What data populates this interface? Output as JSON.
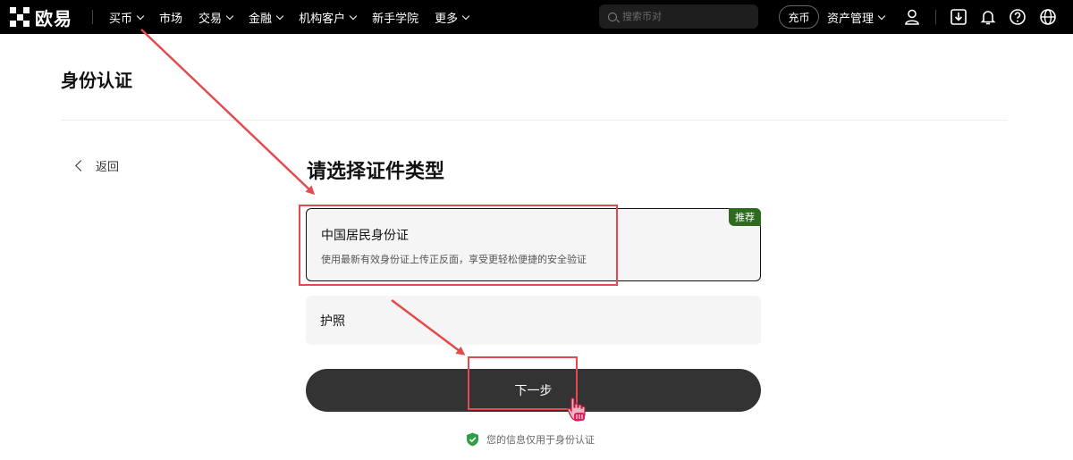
{
  "brand": {
    "name": "欧易"
  },
  "nav": {
    "items": [
      {
        "label": "买币",
        "dropdown": true
      },
      {
        "label": "市场",
        "dropdown": false
      },
      {
        "label": "交易",
        "dropdown": true
      },
      {
        "label": "金融",
        "dropdown": true
      },
      {
        "label": "机构客户",
        "dropdown": true
      },
      {
        "label": "新手学院",
        "dropdown": false
      },
      {
        "label": "更多",
        "dropdown": true
      }
    ],
    "search_placeholder": "搜索币对",
    "deposit_label": "充币",
    "assets_label": "资产管理"
  },
  "page": {
    "title": "身份认证",
    "back_label": "返回",
    "heading": "请选择证件类型",
    "options": [
      {
        "title": "中国居民身份证",
        "desc": "使用最新有效身份证上传正反面，享受更轻松便捷的安全验证",
        "badge": "推荐",
        "selected": true
      },
      {
        "title": "护照",
        "selected": false
      }
    ],
    "next_label": "下一步",
    "privacy_note": "您的信息仅用于身份认证"
  },
  "colors": {
    "annotation": "#e44a4d",
    "badge": "#2f6b1e",
    "primary_button": "#333333"
  }
}
